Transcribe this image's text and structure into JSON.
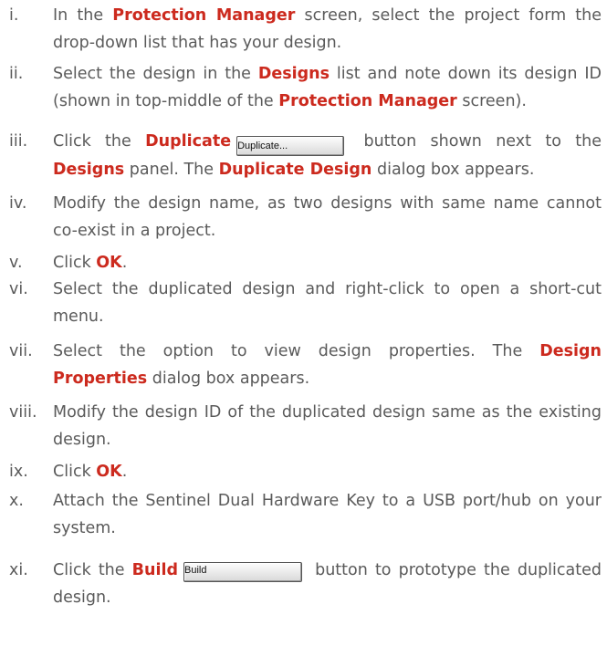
{
  "steps": [
    {
      "num": "i.",
      "parts": [
        {
          "t": "In the "
        },
        {
          "b": "Protection Manager"
        },
        {
          "t": " screen, select the project form the drop-down list that has your design."
        }
      ]
    },
    {
      "num": "ii.",
      "parts": [
        {
          "t": "Select the design in the "
        },
        {
          "b": "Designs"
        },
        {
          "t": " list and note down its design ID (shown in top-middle of the "
        },
        {
          "b": "Protection Manager"
        },
        {
          "t": " screen)."
        }
      ]
    },
    {
      "num": "iii.",
      "parts": [
        {
          "t": "Click the "
        },
        {
          "b": "Duplicate"
        },
        {
          "btn": "Duplicate..."
        },
        {
          "t": " button shown next to the "
        },
        {
          "b": "Designs"
        },
        {
          "t": " panel. The "
        },
        {
          "b": "Duplicate Design"
        },
        {
          "t": " dialog box appears."
        }
      ]
    },
    {
      "num": "iv.",
      "parts": [
        {
          "t": "Modify the design name, as two designs with same name cannot co-exist in a project."
        }
      ]
    },
    {
      "num": "v.",
      "parts": [
        {
          "t": "Click "
        },
        {
          "b": "OK"
        },
        {
          "t": "."
        }
      ]
    },
    {
      "num": "vi.",
      "parts": [
        {
          "t": "Select the duplicated design and right-click to open a short-cut menu."
        }
      ]
    },
    {
      "num": "vii.",
      "parts": [
        {
          "t": "Select the option to view design properties. The "
        },
        {
          "b": "Design Properties"
        },
        {
          "t": " dialog box appears."
        }
      ]
    },
    {
      "num": "viii.",
      "parts": [
        {
          "t": "Modify the design ID of the duplicated design same as the existing design."
        }
      ]
    },
    {
      "num": "ix.",
      "parts": [
        {
          "t": "Click "
        },
        {
          "b": "OK"
        },
        {
          "t": "."
        }
      ]
    },
    {
      "num": "x.",
      "parts": [
        {
          "t": "Attach the Sentinel Dual Hardware Key to a USB port/hub on your system."
        }
      ]
    },
    {
      "num": "xi.",
      "parts": [
        {
          "t": "Click the "
        },
        {
          "b": "Build"
        },
        {
          "btn": "Build"
        },
        {
          "t": " button to prototype the duplicated design."
        }
      ]
    }
  ]
}
